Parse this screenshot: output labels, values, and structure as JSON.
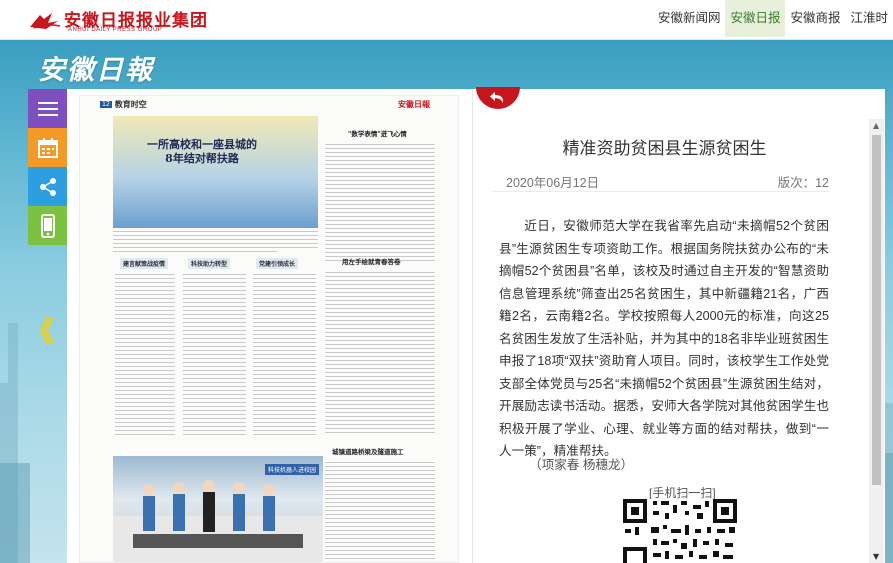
{
  "header": {
    "logo_text": "安徽日报报业集团",
    "logo_sub": "ANHUI DAILY PRESS GROUP",
    "nav": [
      {
        "label": "安徽新闻网",
        "active": false
      },
      {
        "label": "安徽日报",
        "active": true
      },
      {
        "label": "安徽商报",
        "active": false
      },
      {
        "label": "江淮时",
        "active": false
      }
    ]
  },
  "banner": {
    "title": "安徽日報"
  },
  "sidebar": {
    "buttons": [
      {
        "name": "menu-icon",
        "color": "#7f4fbf"
      },
      {
        "name": "calendar-icon",
        "color": "#f39a26"
      },
      {
        "name": "share-icon",
        "color": "#2d9ee0"
      },
      {
        "name": "mobile-icon",
        "color": "#7bc142"
      }
    ],
    "prev_arrow": "《"
  },
  "paper_page": {
    "page_number": "12",
    "section": "教育时空",
    "masthead": "安徽日報",
    "headline_line1": "一所高校和一座县城的",
    "headline_line2": "8年结对帮扶路",
    "subheads": [
      "建言献策战疫情",
      "科技助力转型",
      "党建引领成长"
    ],
    "right_headlines": [
      "\"数学表情\"迸飞心情",
      "用左手绘就青春答卷",
      "城镇道路桥梁及隧道施工"
    ],
    "photo_label": "科技机器人进校园"
  },
  "article": {
    "title": "精准资助贫困县生源贫困生",
    "date": "2020年06月12日",
    "page": "版次：12",
    "body": "近日，安徽师范大学在我省率先启动“未摘帽52个贫困县”生源贫困生专项资助工作。根据国务院扶贫办公布的“未摘帽52个贫困县”名单，该校及时通过自主开发的“智慧资助信息管理系统”筛查出25名贫困生，其中新疆籍21名，广西籍2名，云南籍2名。学校按照每人2000元的标准，向这25名贫困生发放了生活补贴，并为其中的18名非毕业班贫困生申报了18项“双扶”资助育人项目。同时，该校学生工作处党支部全体党员与25名“未摘帽52个贫困县”生源贫困生结对，开展励志读书活动。据悉，安师大各学院对其他贫困学生也积极开展了学业、心理、就业等方面的结对帮扶，做到“一人一策”，精准帮扶。",
    "author": "（项家春 杨穗龙）",
    "qr_label": "[手机扫一扫]"
  },
  "colors": {
    "brand_red": "#c8161d",
    "nav_active_bg": "#e8f0dc",
    "nav_active_text": "#3a7c2c"
  }
}
